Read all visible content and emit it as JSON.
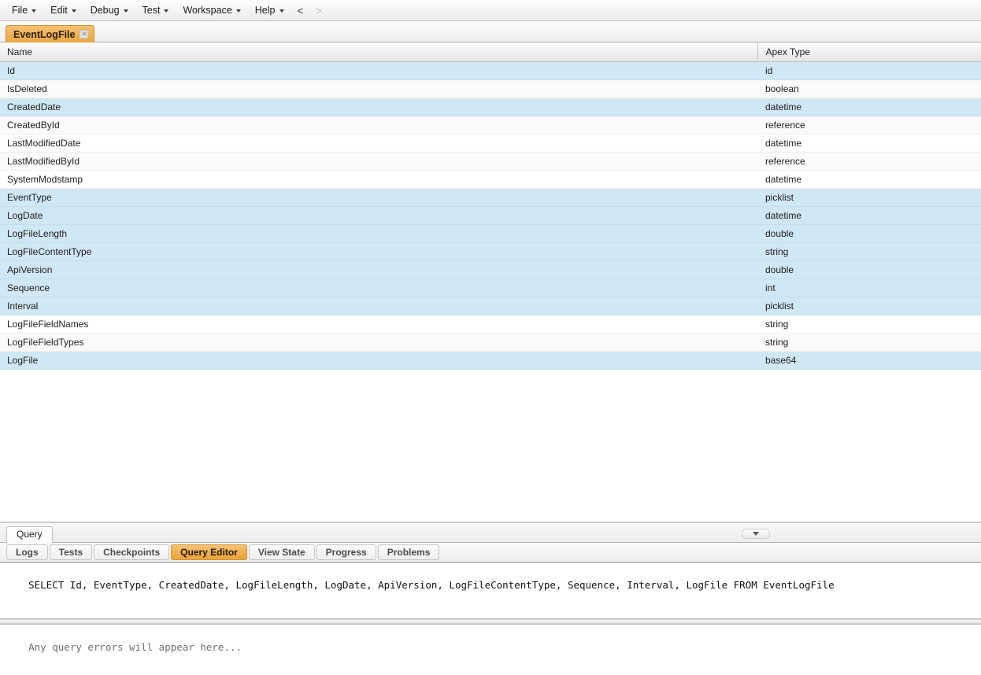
{
  "menubar": {
    "items": [
      {
        "label": "File",
        "has_caret": true
      },
      {
        "label": "Edit",
        "has_caret": true
      },
      {
        "label": "Debug",
        "has_caret": true
      },
      {
        "label": "Test",
        "has_caret": true
      },
      {
        "label": "Workspace",
        "has_caret": true
      },
      {
        "label": "Help",
        "has_caret": true
      }
    ],
    "nav_back": "<",
    "nav_forward": ">"
  },
  "object_tab": {
    "label": "EventLogFile",
    "close_glyph": "×"
  },
  "field_table": {
    "columns": [
      "Name",
      "Apex Type"
    ],
    "rows": [
      {
        "name": "Id",
        "type": "id",
        "style": "sel"
      },
      {
        "name": "IsDeleted",
        "type": "boolean",
        "style": "alt"
      },
      {
        "name": "CreatedDate",
        "type": "datetime",
        "style": "sel"
      },
      {
        "name": "CreatedById",
        "type": "reference",
        "style": "alt"
      },
      {
        "name": "LastModifiedDate",
        "type": "datetime",
        "style": "plain"
      },
      {
        "name": "LastModifiedById",
        "type": "reference",
        "style": "alt"
      },
      {
        "name": "SystemModstamp",
        "type": "datetime",
        "style": "plain"
      },
      {
        "name": "EventType",
        "type": "picklist",
        "style": "sel"
      },
      {
        "name": "LogDate",
        "type": "datetime",
        "style": "sel"
      },
      {
        "name": "LogFileLength",
        "type": "double",
        "style": "sel"
      },
      {
        "name": "LogFileContentType",
        "type": "string",
        "style": "sel"
      },
      {
        "name": "ApiVersion",
        "type": "double",
        "style": "sel"
      },
      {
        "name": "Sequence",
        "type": "int",
        "style": "sel"
      },
      {
        "name": "Interval",
        "type": "picklist",
        "style": "sel"
      },
      {
        "name": "LogFileFieldNames",
        "type": "string",
        "style": "plain"
      },
      {
        "name": "LogFileFieldTypes",
        "type": "string",
        "style": "alt"
      },
      {
        "name": "LogFile",
        "type": "base64",
        "style": "sel"
      }
    ]
  },
  "query_panel": {
    "tab_label": "Query",
    "scroll_nub_icon": "chevron-down-icon"
  },
  "view_tabs": {
    "items": [
      {
        "label": "Logs",
        "active": false
      },
      {
        "label": "Tests",
        "active": false
      },
      {
        "label": "Checkpoints",
        "active": false
      },
      {
        "label": "Query Editor",
        "active": true
      },
      {
        "label": "View State",
        "active": false
      },
      {
        "label": "Progress",
        "active": false
      },
      {
        "label": "Problems",
        "active": false
      }
    ]
  },
  "query_editor": {
    "sql": "SELECT Id, EventType, CreatedDate, LogFileLength, LogDate, ApiVersion, LogFileContentType, Sequence, Interval, LogFile FROM EventLogFile",
    "error_placeholder": "Any query errors will appear here..."
  },
  "colors": {
    "selected_row": "#d0e7f4",
    "active_tab_orange": "#f0ad4e",
    "header_gray": "#e3e3e3"
  }
}
